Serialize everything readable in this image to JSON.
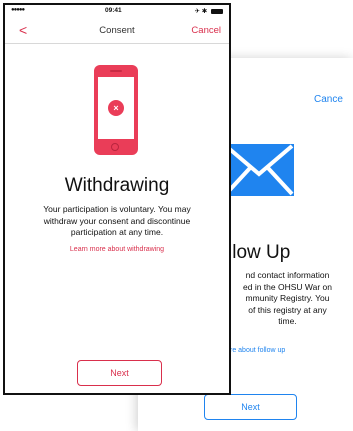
{
  "consent_screen": {
    "status_bar": {
      "signal": "●●●●● ",
      "time": "09:41",
      "icons": "✈ ✱"
    },
    "nav": {
      "back_glyph": "<",
      "title": "Consent",
      "cancel_label": "Cancel"
    },
    "illustration": {
      "icon": "phone-with-x-icon",
      "accent_color": "#ea3d58",
      "x_glyph": "×"
    },
    "title": "Withdrawing",
    "body_lines": [
      "Your participation is voluntary. You may",
      "withdraw your consent and discontinue",
      "participation at any time."
    ],
    "learn_more_link": "Learn more about withdrawing",
    "next_label": "Next",
    "accent_color": "#d92f4c"
  },
  "followup_screen": {
    "cancel_label": "Cance",
    "illustration": {
      "icon": "envelope-icon",
      "color": "#1f84ef"
    },
    "title": "llow Up",
    "body_lines": [
      "nd contact information",
      "ed in the OHSU War on",
      "mmunity Registry. You",
      "of this registry at any",
      "time."
    ],
    "learn_more_link": "re about follow up",
    "next_label": "Next",
    "accent_color": "#1f84ef"
  }
}
